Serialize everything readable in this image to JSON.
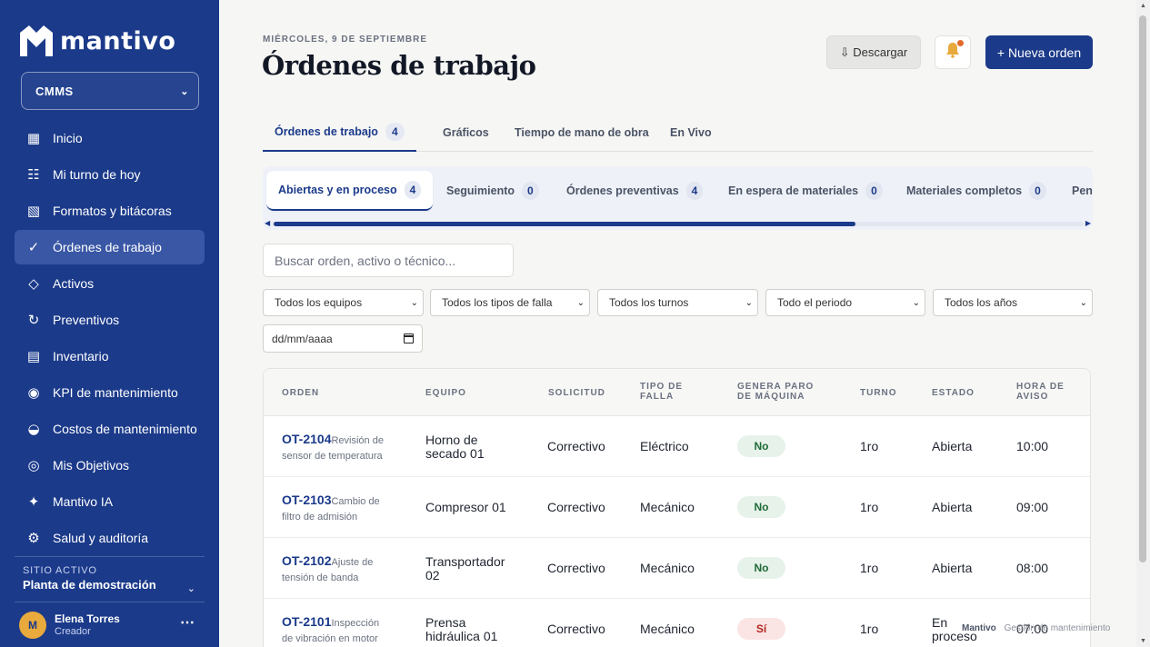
{
  "brand": {
    "name": "mantivo",
    "module": "CMMS"
  },
  "sidebar": {
    "items": [
      {
        "icon": "grid-icon",
        "glyph": "▦",
        "label": "Inicio"
      },
      {
        "icon": "list-icon",
        "glyph": "☷",
        "label": "Mi turno de hoy"
      },
      {
        "icon": "forms-icon",
        "glyph": "▧",
        "label": "Formatos y bitácoras"
      },
      {
        "icon": "check-icon",
        "glyph": "✓",
        "label": "Órdenes de trabajo"
      },
      {
        "icon": "diamond-icon",
        "glyph": "◇",
        "label": "Activos"
      },
      {
        "icon": "refresh-icon",
        "glyph": "↻",
        "label": "Preventivos"
      },
      {
        "icon": "inventory-icon",
        "glyph": "▤",
        "label": "Inventario"
      },
      {
        "icon": "kpi-icon",
        "glyph": "◉",
        "label": "KPI de mantenimiento"
      },
      {
        "icon": "half-circle-icon",
        "glyph": "◒",
        "label": "Costos de mantenimiento"
      },
      {
        "icon": "target-icon",
        "glyph": "◎",
        "label": "Mis Objetivos"
      },
      {
        "icon": "sparkle-icon",
        "glyph": "✦",
        "label": "Mantivo IA"
      },
      {
        "icon": "gear-icon",
        "glyph": "⚙",
        "label": "Salud y auditoría"
      }
    ],
    "site_label": "SITIO ACTIVO",
    "site_name": "Planta de demostración",
    "user": {
      "initial": "M",
      "name": "Elena Torres",
      "role": "Creador"
    }
  },
  "header": {
    "date": "MIÉRCOLES, 9 DE SEPTIEMBRE",
    "title": "Órdenes de trabajo",
    "download_label": "⇩ Descargar",
    "new_order_label": "+ Nueva orden"
  },
  "tabs": [
    {
      "label": "Órdenes de trabajo",
      "count": "4"
    },
    {
      "label": "Gráficos"
    },
    {
      "label": "Tiempo de mano de obra"
    },
    {
      "label": "En Vivo"
    }
  ],
  "subtabs": [
    {
      "label": "Abiertas y en proceso",
      "count": "4"
    },
    {
      "label": "Seguimiento",
      "count": "0"
    },
    {
      "label": "Órdenes preventivas",
      "count": "4"
    },
    {
      "label": "En espera de materiales",
      "count": "0"
    },
    {
      "label": "Materiales completos",
      "count": "0"
    },
    {
      "label": "Pen"
    }
  ],
  "search": {
    "placeholder": "Buscar orden, activo o técnico..."
  },
  "filters": {
    "equipment": "Todos los equipos",
    "failure_type": "Todos los tipos de falla",
    "shift": "Todos los turnos",
    "period": "Todo el periodo",
    "year": "Todos los años",
    "date_placeholder": "dd/mm/aaaa"
  },
  "table": {
    "headers": {
      "order": "ORDEN",
      "equipment": "EQUIPO",
      "request": "SOLICITUD",
      "failure_type_1": "TIPO DE",
      "failure_type_2": "FALLA",
      "stop_1": "GENERA PARO",
      "stop_2": "DE MÁQUINA",
      "shift": "TURNO",
      "status": "ESTADO",
      "time_1": "HORA DE",
      "time_2": "AVISO"
    },
    "rows": [
      {
        "id": "OT-2104",
        "desc": "Revisión de sensor de temperatura",
        "equipment": "Horno de secado 01",
        "request": "Correctivo",
        "failure": "Eléctrico",
        "stop": "No",
        "shift": "1ro",
        "status": "Abierta",
        "time": "10:00"
      },
      {
        "id": "OT-2103",
        "desc": "Cambio de filtro de admisión",
        "equipment": "Compresor 01",
        "request": "Correctivo",
        "failure": "Mecánico",
        "stop": "No",
        "shift": "1ro",
        "status": "Abierta",
        "time": "09:00"
      },
      {
        "id": "OT-2102",
        "desc": "Ajuste de tensión de banda",
        "equipment": "Transportador 02",
        "request": "Correctivo",
        "failure": "Mecánico",
        "stop": "No",
        "shift": "1ro",
        "status": "Abierta",
        "time": "08:00"
      },
      {
        "id": "OT-2101",
        "desc": "Inspección de vibración en motor",
        "equipment": "Prensa hidráulica 01",
        "request": "Correctivo",
        "failure": "Mecánico",
        "stop": "Sí",
        "shift": "1ro",
        "status": "En proceso",
        "time": "07:00"
      }
    ]
  },
  "footer": {
    "brand": "Mantivo",
    "text": "Gestión de mantenimiento"
  },
  "colors": {
    "primary": "#1b3a8a",
    "accent": "#e8a93d",
    "background": "#f6f6f4"
  }
}
